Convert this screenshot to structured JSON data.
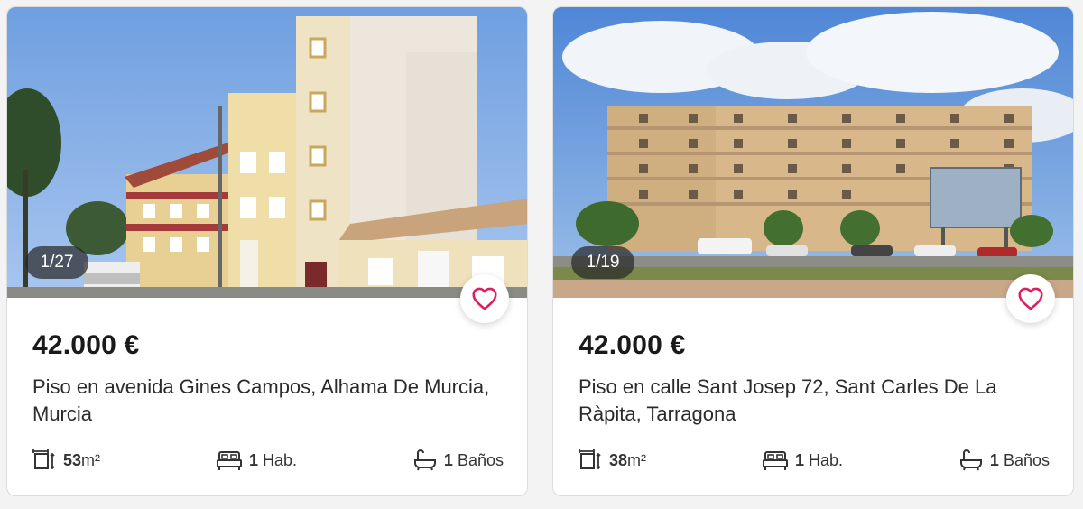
{
  "colors": {
    "accent": "#d9215f",
    "text": "#1a1a1a"
  },
  "listings": [
    {
      "photo_counter": "1/27",
      "price": "42.000 €",
      "title": "Piso en avenida Gines Campos, Alhama De Murcia, Murcia",
      "area": {
        "value": "53",
        "unit": "m²"
      },
      "rooms": {
        "value": "1",
        "label": "Hab."
      },
      "baths": {
        "value": "1",
        "label": "Baños"
      }
    },
    {
      "photo_counter": "1/19",
      "price": "42.000 €",
      "title": "Piso en calle Sant Josep 72, Sant Carles De La Ràpita, Tarragona",
      "area": {
        "value": "38",
        "unit": "m²"
      },
      "rooms": {
        "value": "1",
        "label": "Hab."
      },
      "baths": {
        "value": "1",
        "label": "Baños"
      }
    }
  ],
  "icons": {
    "favorite": "heart-icon",
    "area": "area-icon",
    "rooms": "bed-icon",
    "baths": "bathtub-icon"
  }
}
